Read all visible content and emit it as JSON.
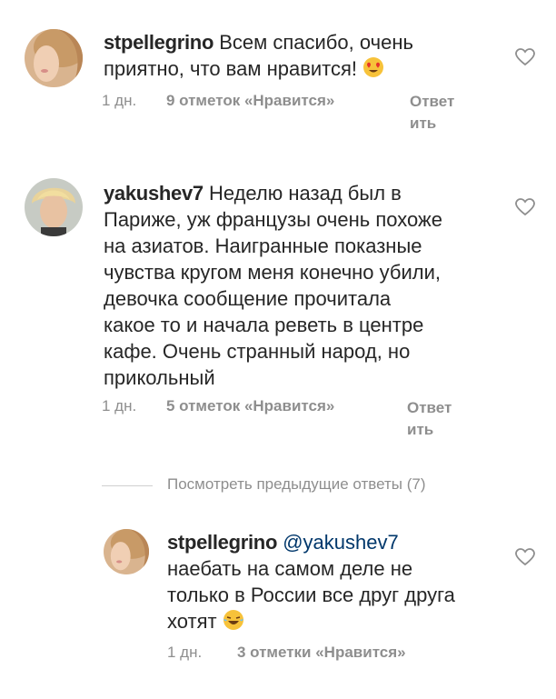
{
  "comments": [
    {
      "username": "stpellegrino",
      "text_line1": "Всем спасибо, очень",
      "text_line2": "приятно, что вам нравится!",
      "emoji": "heart-eyes-emoji",
      "time": "1 дн.",
      "likes": "9 отметок «Нравится»",
      "reply_line1": "Ответ",
      "reply_line2": "ить"
    },
    {
      "username": "yakushev7",
      "text_line1": "Неделю назад был в",
      "lines": [
        "Париже, уж французы очень похоже",
        "на азиатов. Наигранные показные",
        "чувства кругом меня конечно убили,",
        "девочка сообщение прочитала",
        "какое то и начала реветь в центре",
        "кафе. Очень странный народ, но",
        "прикольный"
      ],
      "time": "1 дн.",
      "likes": "5 отметок «Нравится»",
      "reply_line1": "Ответ",
      "reply_line2": "ить"
    }
  ],
  "view_previous": "Посмотреть предыдущие ответы (7)",
  "reply": {
    "username": "stpellegrino",
    "mention": "@yakushev7",
    "lines": [
      "наебать на самом деле не",
      "только в России все друг друга",
      "хотят"
    ],
    "emoji": "laughing-tears-emoji",
    "time": "1 дн.",
    "likes": "3 отметки «Нравится»"
  },
  "colors": {
    "text": "#262626",
    "muted": "#8e8e8e",
    "mention": "#00376b"
  }
}
